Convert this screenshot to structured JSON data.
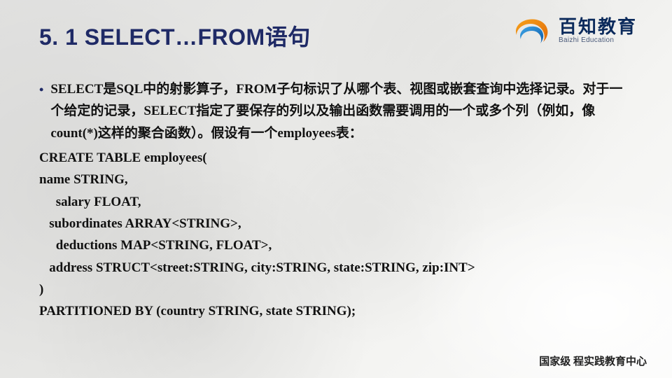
{
  "title": "5. 1 SELECT…FROM语句",
  "logo": {
    "cn": "百知教育",
    "en": "Baizhi Education"
  },
  "bullet": "SELECT是SQL中的射影算子，FROM子句标识了从哪个表、视图或嵌套查询中选择记录。对于一个给定的记录，SELECT指定了要保存的列以及输出函数需要调用的一个或多个列（例如，像count(*)这样的聚合函数）。假设有一个employees表：",
  "code": {
    "l1": "CREATE TABLE employees(",
    "l2": "name STRING,",
    "l3": "     salary FLOAT,",
    "l4": "   subordinates ARRAY<STRING>,",
    "l5": "     deductions MAP<STRING, FLOAT>,",
    "l6": "   address STRUCT<street:STRING, city:STRING, state:STRING, zip:INT>",
    "l7": ")",
    "l8": "PARTITIONED BY (country STRING, state STRING);"
  },
  "footer": "国家级 程实践教育中心"
}
